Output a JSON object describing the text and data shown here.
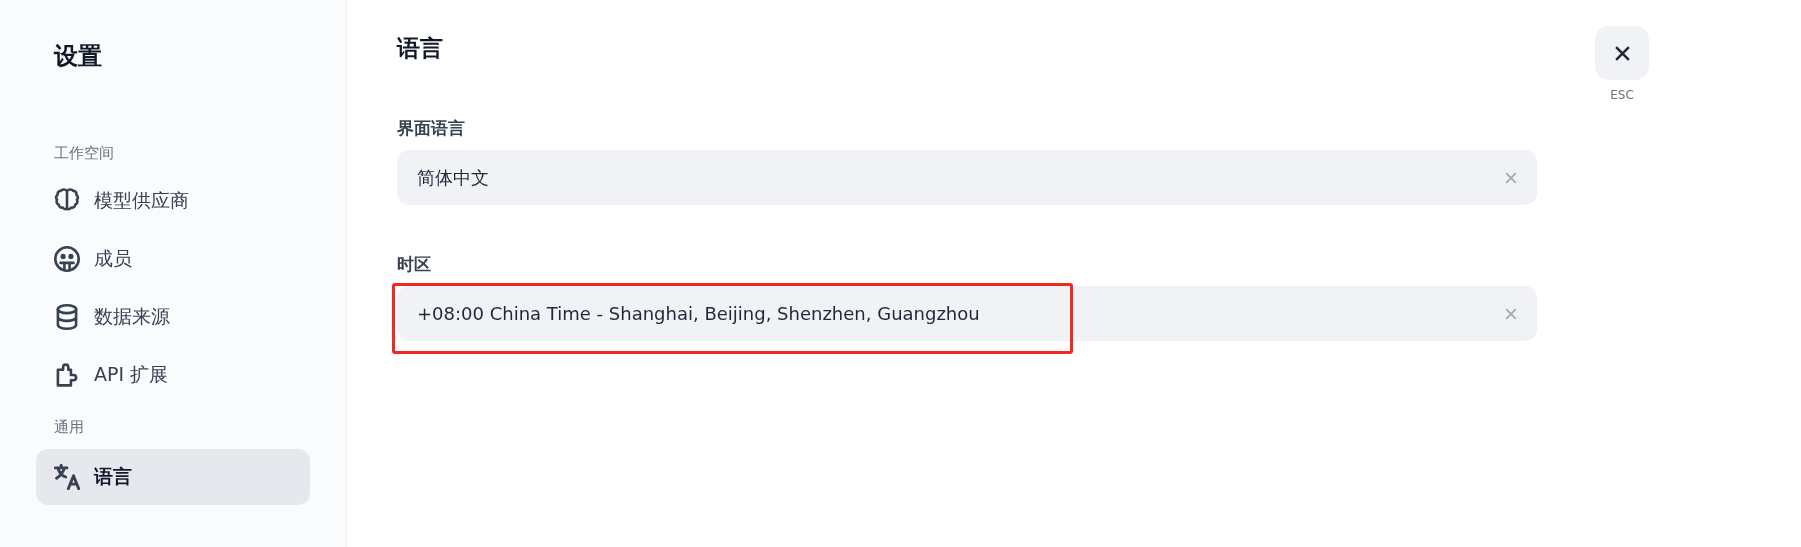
{
  "sidebar": {
    "title": "设置",
    "sections": [
      {
        "heading": "工作空间",
        "items": [
          {
            "label": "模型供应商",
            "kind": "brain",
            "selected": false
          },
          {
            "label": "成员",
            "kind": "face",
            "selected": false
          },
          {
            "label": "数据来源",
            "kind": "database",
            "selected": false
          },
          {
            "label": "API 扩展",
            "kind": "puzzle",
            "selected": false
          }
        ]
      },
      {
        "heading": "通用",
        "items": [
          {
            "label": "语言",
            "kind": "translate",
            "selected": true
          }
        ]
      }
    ]
  },
  "main": {
    "title": "语言",
    "fields": [
      {
        "label": "界面语言",
        "value": "简体中文",
        "highlighted": false
      },
      {
        "label": "时区",
        "value": "+08:00 China Time - Shanghai, Beijing, Shenzhen, Guangzhou",
        "highlighted": true
      }
    ]
  },
  "close": {
    "hint": "ESC"
  }
}
